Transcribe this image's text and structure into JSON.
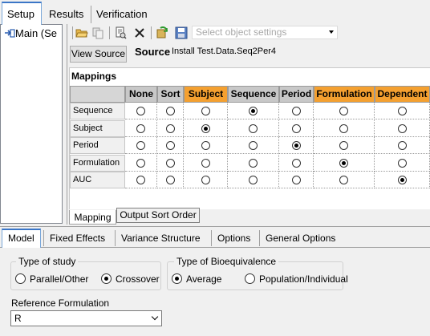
{
  "top_tabs": [
    "Setup",
    "Results",
    "Verification"
  ],
  "tree": {
    "root_label": "Main (Se"
  },
  "toolbar": {
    "icons": [
      "open-icon",
      "copy-icon",
      "import-icon",
      "delete-icon",
      "refresh-icon",
      "save-icon"
    ],
    "object_settings_placeholder": "Select object settings"
  },
  "source": {
    "button_label": "View Source",
    "label": "Source",
    "value": "Install Test.Data.Seq2Per4"
  },
  "mappings": {
    "title": "Mappings",
    "columns": [
      {
        "label": "None",
        "highlight": false
      },
      {
        "label": "Sort",
        "highlight": false
      },
      {
        "label": "Subject",
        "highlight": true
      },
      {
        "label": "Sequence",
        "highlight": false
      },
      {
        "label": "Period",
        "highlight": false
      },
      {
        "label": "Formulation",
        "highlight": true
      },
      {
        "label": "Dependent",
        "highlight": true
      }
    ],
    "rows": [
      {
        "label": "Sequence",
        "selected": 3
      },
      {
        "label": "Subject",
        "selected": 2
      },
      {
        "label": "Period",
        "selected": 4
      },
      {
        "label": "Formulation",
        "selected": 5
      },
      {
        "label": "AUC",
        "selected": 6
      }
    ],
    "highlight_color": "#f4a030"
  },
  "mapping_tabs": [
    "Mapping",
    "Output Sort Order"
  ],
  "lower_tabs": [
    "Model",
    "Fixed Effects",
    "Variance Structure",
    "Options",
    "General Options"
  ],
  "study_type": {
    "title": "Type of study",
    "options": [
      {
        "label": "Parallel/Other",
        "selected": false
      },
      {
        "label": "Crossover",
        "selected": true
      }
    ]
  },
  "bioequivalence": {
    "title": "Type of Bioequivalence",
    "options": [
      {
        "label": "Average",
        "selected": true
      },
      {
        "label": "Population/Individual",
        "selected": false
      }
    ]
  },
  "reference_formulation": {
    "label": "Reference Formulation",
    "value": "R"
  }
}
